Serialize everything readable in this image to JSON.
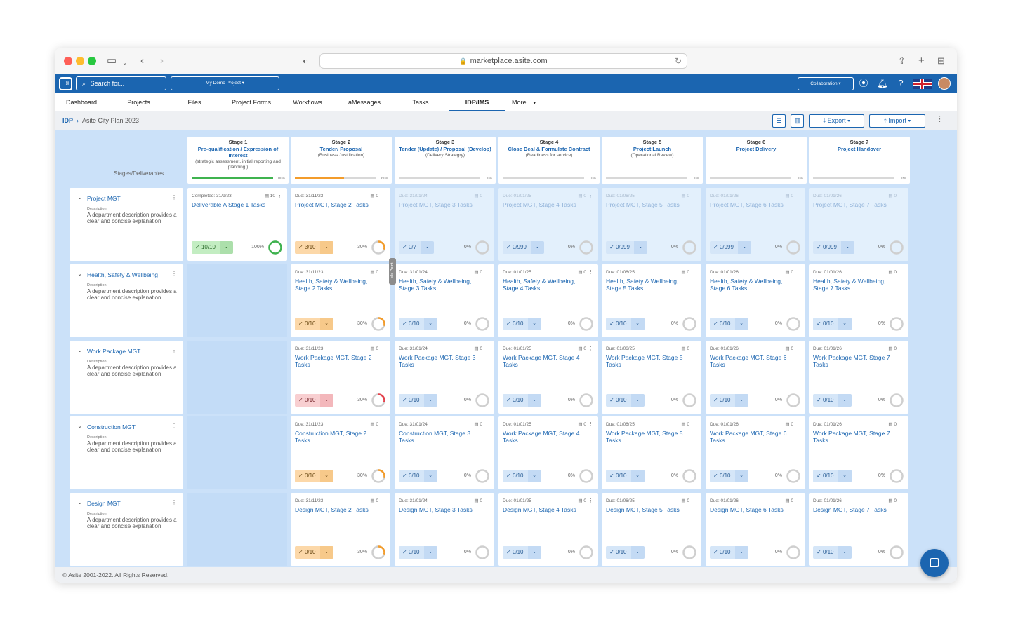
{
  "browser": {
    "url": "marketplace.asite.com"
  },
  "header": {
    "search_placeholder": "Search for...",
    "project": "My Demo Project",
    "collaboration": "Collaboration"
  },
  "nav": {
    "tabs": [
      {
        "label": "Dashboard"
      },
      {
        "label": "Projects"
      },
      {
        "label": "Files"
      },
      {
        "label": "Project Forms"
      },
      {
        "label": "Workflows"
      },
      {
        "label": "aMessages"
      },
      {
        "label": "Tasks"
      },
      {
        "label": "IDP/IMS"
      },
      {
        "label": "More..."
      }
    ],
    "active": "IDP/IMS"
  },
  "breadcrumb": {
    "root": "IDP",
    "current": "Asite City Plan 2023"
  },
  "toolbar": {
    "export": "Export",
    "import": "Import"
  },
  "board": {
    "stages_label": "Stages/Deliverables",
    "hold_point": "Hold Point",
    "stages": [
      {
        "no": "Stage 1",
        "name": "Pre-qualification / Expression of Interest",
        "desc": "(strategic assessment, initial reporting and planning )",
        "progress": "100%",
        "progress_value": 100,
        "bar_color": "#3fb34f"
      },
      {
        "no": "Stage 2",
        "name": "Tender/ Proposal",
        "desc": "(Business Justification)",
        "progress": "60%",
        "progress_value": 60,
        "bar_color": "#f39c2b"
      },
      {
        "no": "Stage 3",
        "name": "Tender (Update) / Proposal (Develop)",
        "desc": "(Delivery Strategry)",
        "progress": "0%",
        "progress_value": 0,
        "bar_color": "#cccccc"
      },
      {
        "no": "Stage 4",
        "name": "Close Deal & Formulate Contract",
        "desc": "(Readiness for service)",
        "progress": "0%",
        "progress_value": 0,
        "bar_color": "#cccccc"
      },
      {
        "no": "Stage 5",
        "name": "Project Launch",
        "desc": "(Operational Review)",
        "progress": "0%",
        "progress_value": 0,
        "bar_color": "#cccccc"
      },
      {
        "no": "Stage 6",
        "name": "Project Delivery",
        "desc": "",
        "progress": "0%",
        "progress_value": 0,
        "bar_color": "#cccccc"
      },
      {
        "no": "Stage 7",
        "name": "Project Handover",
        "desc": "",
        "progress": "0%",
        "progress_value": 0,
        "bar_color": "#cccccc"
      }
    ],
    "departments": [
      {
        "name": "Project MGT",
        "desc_label": "Description:",
        "desc": "A department description provides a clear and concise explanation",
        "cells": [
          {
            "due": "Completed: 31/9/23",
            "comments": "10",
            "title": "Deliverable A Stage 1 Tasks",
            "count": "10/10",
            "pct": "100%",
            "value": 100,
            "status": "green",
            "future": false
          },
          {
            "due": "Due: 31/11/23",
            "comments": "0",
            "title": "Project MGT, Stage 2 Tasks",
            "count": "3/10",
            "pct": "30%",
            "value": 30,
            "status": "orange",
            "future": false
          },
          {
            "due": "Due: 31/01/24",
            "comments": "0",
            "title": "Project MGT, Stage 3 Tasks",
            "count": "0/7",
            "pct": "0%",
            "value": 0,
            "status": "blue",
            "future": true
          },
          {
            "due": "Due: 01/01/25",
            "comments": "0",
            "title": "Project MGT, Stage 4 Tasks",
            "count": "0/999",
            "pct": "0%",
            "value": 0,
            "status": "blue",
            "future": true
          },
          {
            "due": "Due: 01/06/25",
            "comments": "0",
            "title": "Project MGT, Stage 5 Tasks",
            "count": "0/999",
            "pct": "0%",
            "value": 0,
            "status": "blue",
            "future": true
          },
          {
            "due": "Due: 01/01/26",
            "comments": "0",
            "title": "Project MGT, Stage 6 Tasks",
            "count": "0/999",
            "pct": "0%",
            "value": 0,
            "status": "blue",
            "future": true
          },
          {
            "due": "Due: 01/01/26",
            "comments": "0",
            "title": "Project MGT, Stage 7 Tasks",
            "count": "0/999",
            "pct": "0%",
            "value": 0,
            "status": "blue",
            "future": true
          }
        ]
      },
      {
        "name": "Health, Safety & Wellbeing",
        "desc_label": "Description:",
        "desc": "A department description provides a clear and concise explanation",
        "cells": [
          null,
          {
            "due": "Due: 31/11/23",
            "comments": "0",
            "title": "Health, Safety & Wellbeing, Stage 2 Tasks",
            "count": "0/10",
            "pct": "30%",
            "value": 30,
            "status": "orange",
            "future": false
          },
          {
            "due": "Due: 31/01/24",
            "comments": "0",
            "title": "Health, Safety & Wellbeing, Stage 3 Tasks",
            "count": "0/10",
            "pct": "0%",
            "value": 0,
            "status": "blue",
            "future": false
          },
          {
            "due": "Due: 01/01/25",
            "comments": "0",
            "title": "Health, Safety & Wellbeing, Stage 4 Tasks",
            "count": "0/10",
            "pct": "0%",
            "value": 0,
            "status": "blue",
            "future": false
          },
          {
            "due": "Due: 01/06/25",
            "comments": "0",
            "title": "Health, Safety & Wellbeing, Stage 5 Tasks",
            "count": "0/10",
            "pct": "0%",
            "value": 0,
            "status": "blue",
            "future": false
          },
          {
            "due": "Due: 01/01/26",
            "comments": "0",
            "title": "Health, Safety & Wellbeing, Stage 6 Tasks",
            "count": "0/10",
            "pct": "0%",
            "value": 0,
            "status": "blue",
            "future": false
          },
          {
            "due": "Due: 01/01/26",
            "comments": "0",
            "title": "Health, Safety & Wellbeing, Stage 7 Tasks",
            "count": "0/10",
            "pct": "0%",
            "value": 0,
            "status": "blue",
            "future": false
          }
        ]
      },
      {
        "name": "Work Package MGT",
        "desc_label": "Description:",
        "desc": "A department description provides a clear and concise explanation",
        "cells": [
          null,
          {
            "due": "Due: 31/11/23",
            "comments": "0",
            "title": "Work Package MGT, Stage 2 Tasks",
            "count": "0/10",
            "pct": "30%",
            "value": 30,
            "status": "red",
            "future": false
          },
          {
            "due": "Due: 31/01/24",
            "comments": "0",
            "title": "Work Package MGT, Stage 3 Tasks",
            "count": "0/10",
            "pct": "0%",
            "value": 0,
            "status": "blue",
            "future": false
          },
          {
            "due": "Due: 01/01/25",
            "comments": "0",
            "title": "Work Package MGT, Stage 4 Tasks",
            "count": "0/10",
            "pct": "0%",
            "value": 0,
            "status": "blue",
            "future": false
          },
          {
            "due": "Due: 01/06/25",
            "comments": "0",
            "title": "Work Package MGT, Stage 5 Tasks",
            "count": "0/10",
            "pct": "0%",
            "value": 0,
            "status": "blue",
            "future": false
          },
          {
            "due": "Due: 01/01/26",
            "comments": "0",
            "title": "Work Package MGT, Stage 6 Tasks",
            "count": "0/10",
            "pct": "0%",
            "value": 0,
            "status": "blue",
            "future": false
          },
          {
            "due": "Due: 01/01/26",
            "comments": "0",
            "title": "Work Package MGT, Stage 7 Tasks",
            "count": "0/10",
            "pct": "0%",
            "value": 0,
            "status": "blue",
            "future": false
          }
        ]
      },
      {
        "name": "Construction MGT",
        "desc_label": "Description:",
        "desc": "A department description provides a clear and concise explanation",
        "cells": [
          null,
          {
            "due": "Due: 31/11/23",
            "comments": "0",
            "title": "Construction MGT, Stage 2 Tasks",
            "count": "0/10",
            "pct": "30%",
            "value": 30,
            "status": "orange",
            "future": false
          },
          {
            "due": "Due: 31/01/24",
            "comments": "0",
            "title": "Construction MGT, Stage 3 Tasks",
            "count": "0/10",
            "pct": "0%",
            "value": 0,
            "status": "blue",
            "future": false
          },
          {
            "due": "Due: 01/01/25",
            "comments": "0",
            "title": "Work Package MGT, Stage 4 Tasks",
            "count": "0/10",
            "pct": "0%",
            "value": 0,
            "status": "blue",
            "future": false
          },
          {
            "due": "Due: 01/06/25",
            "comments": "0",
            "title": "Work Package MGT, Stage 5 Tasks",
            "count": "0/10",
            "pct": "0%",
            "value": 0,
            "status": "blue",
            "future": false
          },
          {
            "due": "Due: 01/01/26",
            "comments": "0",
            "title": "Work Package MGT, Stage 6 Tasks",
            "count": "0/10",
            "pct": "0%",
            "value": 0,
            "status": "blue",
            "future": false
          },
          {
            "due": "Due: 01/01/26",
            "comments": "0",
            "title": "Work Package MGT, Stage 7 Tasks",
            "count": "0/10",
            "pct": "0%",
            "value": 0,
            "status": "blue",
            "future": false
          }
        ]
      },
      {
        "name": "Design MGT",
        "desc_label": "Description:",
        "desc": "A department description provides a clear and concise explanation",
        "cells": [
          null,
          {
            "due": "Due: 31/11/23",
            "comments": "0",
            "title": "Design MGT, Stage 2 Tasks",
            "count": "0/10",
            "pct": "30%",
            "value": 30,
            "status": "orange",
            "future": false
          },
          {
            "due": "Due: 31/01/24",
            "comments": "0",
            "title": "Design MGT, Stage 3 Tasks",
            "count": "0/10",
            "pct": "0%",
            "value": 0,
            "status": "blue",
            "future": false
          },
          {
            "due": "Due: 01/01/25",
            "comments": "0",
            "title": "Design MGT, Stage 4 Tasks",
            "count": "0/10",
            "pct": "0%",
            "value": 0,
            "status": "blue",
            "future": false
          },
          {
            "due": "Due: 01/06/25",
            "comments": "0",
            "title": "Design MGT, Stage 5 Tasks",
            "count": "0/10",
            "pct": "0%",
            "value": 0,
            "status": "blue",
            "future": false
          },
          {
            "due": "Due: 01/01/26",
            "comments": "0",
            "title": "Design MGT, Stage 6 Tasks",
            "count": "0/10",
            "pct": "0%",
            "value": 0,
            "status": "blue",
            "future": false
          },
          {
            "due": "Due: 01/01/26",
            "comments": "0",
            "title": "Design MGT, Stage 7 Tasks",
            "count": "0/10",
            "pct": "0%",
            "value": 0,
            "status": "blue",
            "future": false
          }
        ]
      }
    ]
  },
  "status_colors": {
    "green": "#3fb34f",
    "orange": "#f39c2b",
    "red": "#e5414b",
    "empty": "#cfcfcf"
  },
  "footer": {
    "copyright": "© Asite 2001-2022. All Rights Reserved."
  }
}
